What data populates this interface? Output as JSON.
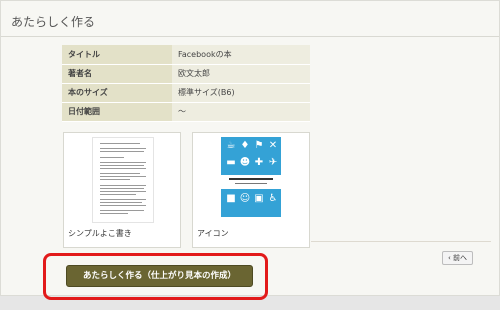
{
  "header": {
    "title": "あたらしく作る"
  },
  "info": [
    {
      "label": "タイトル",
      "value": "Facebookの本"
    },
    {
      "label": "著者名",
      "value": "欧文太郎"
    },
    {
      "label": "本のサイズ",
      "value": "標準サイズ(B6)"
    },
    {
      "label": "日付範囲",
      "value": "～"
    }
  ],
  "cards": [
    {
      "label": "シンプルよこ書き"
    },
    {
      "label": "アイコン"
    }
  ],
  "buttons": {
    "prev": "前へ",
    "create": "あたらしく作る（仕上がり見本の作成）"
  },
  "colors": {
    "create_button": "#6a6532",
    "highlight": "#e21a1a",
    "icon_cover": "#34a2d6",
    "table_header": "#e3e1c8"
  }
}
